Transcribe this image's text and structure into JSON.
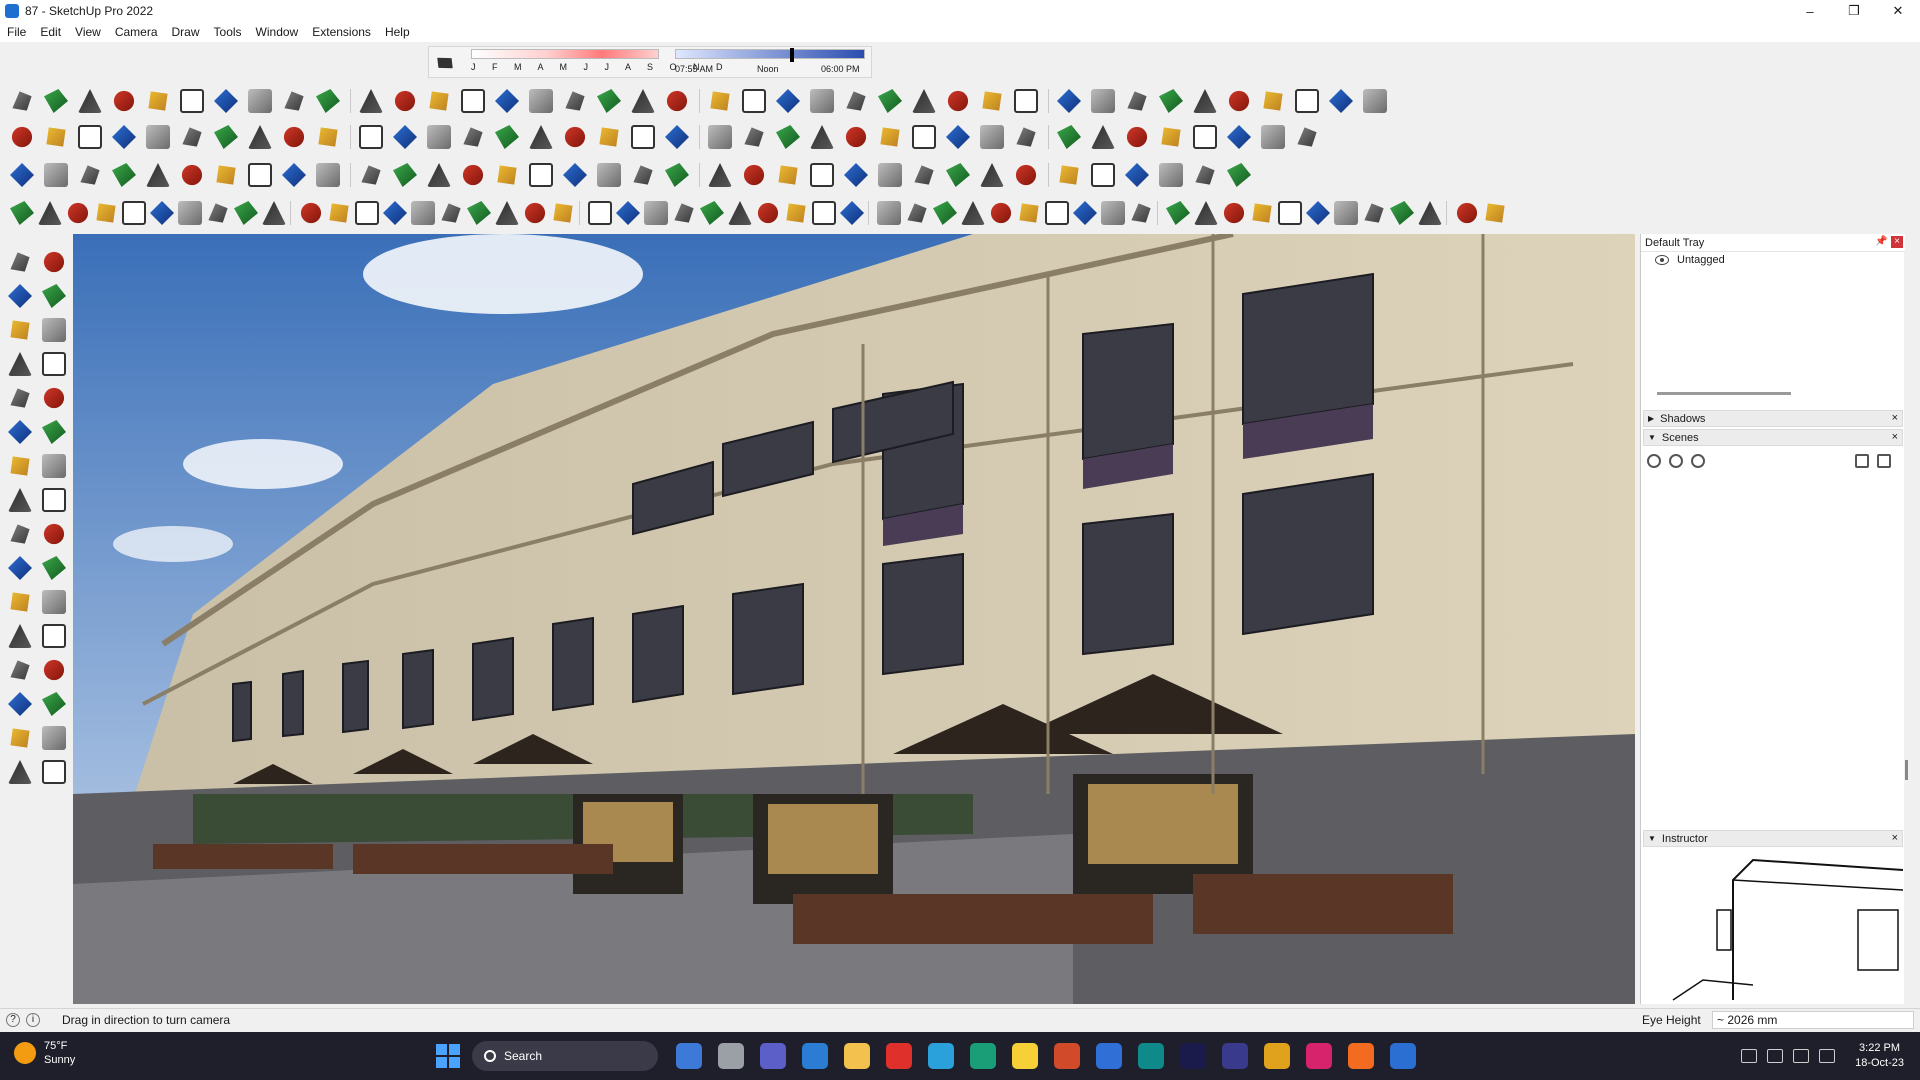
{
  "window": {
    "title": "87 - SketchUp Pro 2022",
    "minimize": "–",
    "maximize": "❐",
    "close": "✕"
  },
  "menu": [
    "File",
    "Edit",
    "View",
    "Camera",
    "Draw",
    "Tools",
    "Window",
    "Extensions",
    "Help"
  ],
  "shadow_settings": {
    "months": "J F M A M J J A S O N D",
    "time_sunrise": "07:55 AM",
    "time_noon": "Noon",
    "time_sunset": "06:00 PM"
  },
  "default_tray": {
    "title": "Default Tray",
    "pin": "📌",
    "close": "×",
    "tag_name": "Untagged"
  },
  "panels": {
    "shadows": {
      "title": "Shadows",
      "close": "×"
    },
    "scenes": {
      "title": "Scenes",
      "close": "×"
    },
    "instructor": {
      "title": "Instructor",
      "close": "×"
    }
  },
  "status": {
    "message": "Drag in direction to turn camera",
    "measure_label": "Eye Height",
    "measure_value": "~ 2026 mm"
  },
  "taskbar": {
    "weather_temp": "75°F",
    "weather_desc": "Sunny",
    "search_label": "Search",
    "time": "3:22 PM",
    "date": "18-Oct-23"
  },
  "colors": {
    "accent": "#1f6fd0",
    "taskbar_bg": "#1f1f2b",
    "close_red": "#d13438"
  },
  "icons": {
    "large_tool_set_top": [
      "select-arrow-icon",
      "paint-bucket-icon",
      "eraser-icon",
      "orbit-icon",
      "pan-icon",
      "zoom-icon",
      "line-icon",
      "freehand-icon",
      "rectangle-icon",
      "rotated-rectangle-icon",
      "circle-icon",
      "polygon-icon",
      "arc-icon",
      "two-point-arc-icon",
      "pie-icon",
      "push-pull-icon",
      "move-icon",
      "rotate-icon",
      "scale-icon",
      "follow-me-icon",
      "offset-icon",
      "tape-measure-icon",
      "text-icon",
      "protractor-icon",
      "axes-icon",
      "dimension-icon",
      "section-plane-icon",
      "zoom-window-icon",
      "zoom-extents-icon",
      "walk-icon",
      "look-around-icon",
      "position-camera-icon"
    ]
  }
}
